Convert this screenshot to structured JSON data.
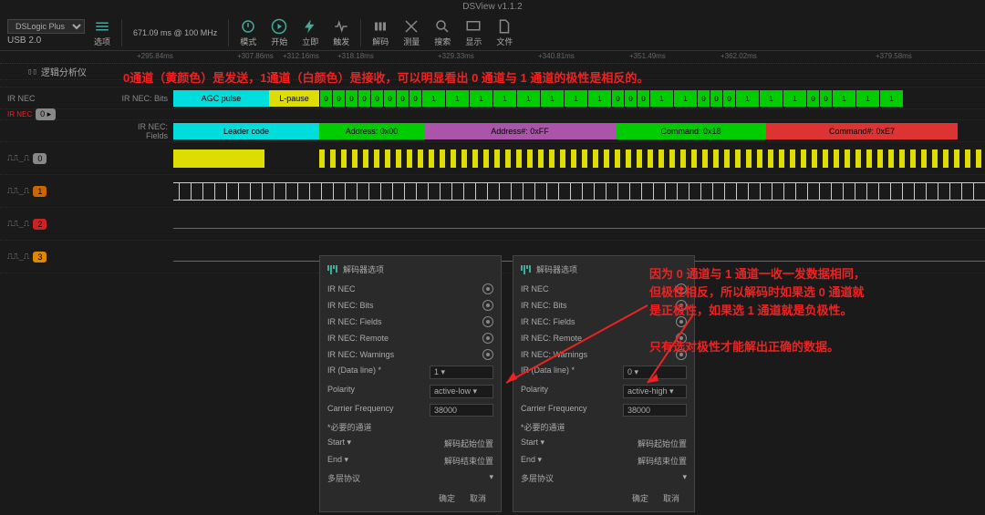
{
  "app_title": "DSView v1.1.2",
  "device_model": "DSLogic Plus",
  "usb_label": "USB 2.0",
  "sample_info": "671.09 ms @ 100 MHz",
  "toolbar": {
    "options": "选项",
    "mode": "模式",
    "start": "开始",
    "instant": "立即",
    "trigger": "触发",
    "decode": "解码",
    "measure": "测量",
    "search": "搜索",
    "display": "显示",
    "file": "文件"
  },
  "timeline_ticks": [
    "295.84ms",
    "307.86ms",
    "312.16ms",
    "318.18ms",
    "329.33ms",
    "340.81ms",
    "351.49ms",
    "362.02ms",
    "379.58ms"
  ],
  "analyzer_label": "逻辑分析仪",
  "annotation_top": "0通道（黄颜色）是发送，1通道（白颜色）是接收，可以明显看出 0 通道与 1 通道的极性是相反的。",
  "ir_label": "IR NEC",
  "bits_label": "IR NEC: Bits",
  "fields_label": "IR NEC: Fields",
  "segments": {
    "agc": "AGC pulse",
    "lpause": "L-pause",
    "leader": "Leader code",
    "address": "Address: 0x00",
    "address_n": "Address#: 0xFF",
    "command": "Command: 0x18",
    "command_n": "Command#: 0xE7"
  },
  "bit_stream": [
    "0",
    "0",
    "0",
    "0",
    "0",
    "0",
    "0",
    "0",
    "1",
    "1",
    "1",
    "1",
    "1",
    "1",
    "1",
    "1",
    "0",
    "0",
    "0",
    "1",
    "1",
    "0",
    "0",
    "0",
    "1",
    "1",
    "1",
    "0",
    "0",
    "1",
    "1",
    "1"
  ],
  "channel_labels": [
    "0",
    "1",
    "2",
    "3"
  ],
  "dialog_title": "解码器选项",
  "dialog_items": [
    "IR NEC",
    "IR NEC: Bits",
    "IR NEC: Fields",
    "IR NEC: Remote",
    "IR NEC: Warnings"
  ],
  "dialog_dataline": "IR (Data line) *",
  "dialog_polarity": "Polarity",
  "dialog_carrier": "Carrier Frequency",
  "dialog_carrier_val": "38000",
  "dialog_required": "*必要的通道",
  "dialog_start": "Start",
  "dialog_start_val": "解码起始位置",
  "dialog_end": "End",
  "dialog_end_val": "解码结束位置",
  "dialog_multi": "多层协议",
  "dialog_ok": "确定",
  "dialog_cancel": "取消",
  "dlg1": {
    "dataline": "1",
    "polarity": "active-low"
  },
  "dlg2": {
    "dataline": "0",
    "polarity": "active-high"
  },
  "ann_right1": "因为 0 通道与 1 通道一收一发数据相同，",
  "ann_right2": "但极性相反，所以解码时如果选 0 通道就",
  "ann_right3": "是正极性，如果选 1 通道就是负极性。",
  "ann_right4": "只有选对极性才能解出正确的数据。"
}
